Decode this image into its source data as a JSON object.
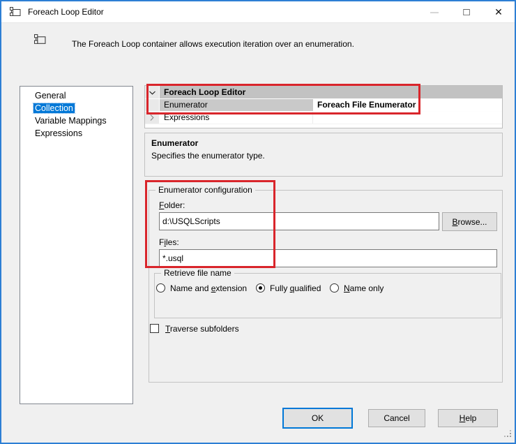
{
  "window": {
    "title": "Foreach Loop Editor"
  },
  "titlebar_icons": {
    "minimize": "—",
    "maximize": "□",
    "close": "✕"
  },
  "header": {
    "description": "The Foreach Loop container allows execution iteration over an enumeration."
  },
  "nav": {
    "selected_item": "Collection",
    "items": [
      {
        "label": "General"
      },
      {
        "label": "Collection"
      },
      {
        "label": "Variable Mappings"
      },
      {
        "label": "Expressions"
      }
    ]
  },
  "grid": {
    "category": "Foreach Loop Editor",
    "rows": [
      {
        "name": "Enumerator",
        "value": "Foreach File Enumerator"
      },
      {
        "name": "Expressions",
        "value": ""
      }
    ]
  },
  "desc_panel": {
    "title": "Enumerator",
    "text": "Specifies the enumerator type."
  },
  "config": {
    "legend": "Enumerator configuration",
    "folder_label": {
      "pre": "",
      "key": "F",
      "post": "older:"
    },
    "folder_value": "d:\\USQLScripts",
    "browse": {
      "pre": "",
      "key": "B",
      "post": "rowse..."
    },
    "files_label": {
      "pre": "F",
      "key": "i",
      "post": "les:"
    },
    "files_value": "*.usql",
    "retrieve": {
      "legend": "Retrieve file name",
      "options": [
        {
          "pre": "Name and ",
          "key": "e",
          "post": "xtension",
          "selected": false
        },
        {
          "pre": "Fully ",
          "key": "q",
          "post": "ualified",
          "selected": true
        },
        {
          "pre": "",
          "key": "N",
          "post": "ame only",
          "selected": false
        }
      ]
    },
    "traverse": {
      "pre": "",
      "key": "T",
      "post": "raverse subfolders",
      "checked": false
    }
  },
  "footer": {
    "ok": "OK",
    "cancel": "Cancel",
    "help": {
      "pre": "",
      "key": "H",
      "post": "elp"
    }
  },
  "colors": {
    "accent_blue": "#0078d7",
    "annotation_red": "#d9252b",
    "selection_blue": "#0078d7"
  }
}
